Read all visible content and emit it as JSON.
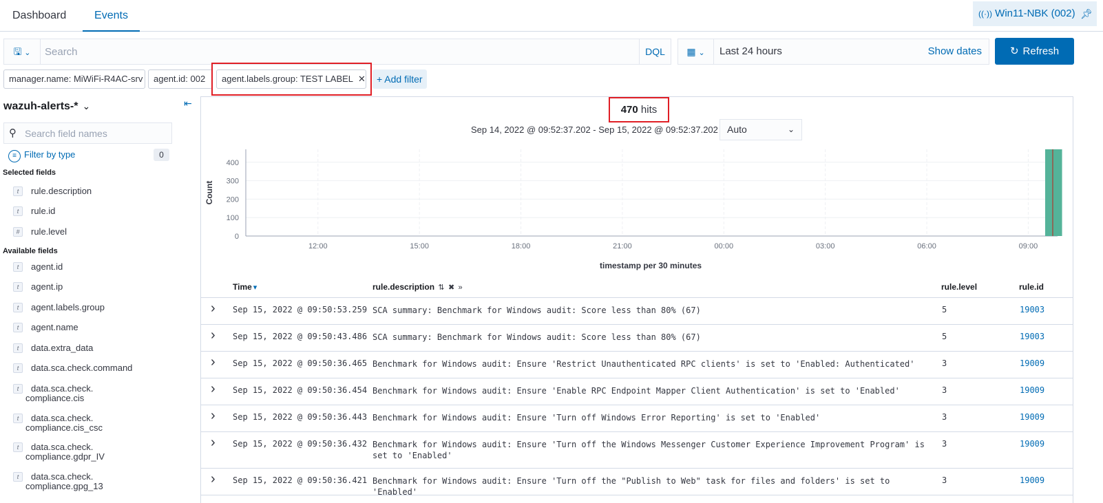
{
  "tabs": {
    "dashboard": "Dashboard",
    "events": "Events"
  },
  "agent_chip": {
    "label": "Win11-NBK (002)",
    "icon": "signal-icon",
    "pin_icon": "pin-icon"
  },
  "query": {
    "placeholder": "Search",
    "language": "DQL"
  },
  "date_picker": {
    "range": "Last 24 hours",
    "show_dates": "Show dates"
  },
  "refresh": {
    "label": "Refresh"
  },
  "filters": [
    {
      "label": "manager.name: MiWiFi-R4AC-srv"
    },
    {
      "label": "agent.id: 002"
    },
    {
      "label": "agent.labels.group: TEST LABEL"
    }
  ],
  "add_filter": "+ Add filter",
  "sidebar": {
    "index_pattern": "wazuh-alerts-*",
    "search_placeholder": "Search field names",
    "filter_by_type": "Filter by type",
    "filter_count": "0",
    "selected_title": "Selected fields",
    "selected_fields": [
      {
        "type": "t",
        "name": "rule.description"
      },
      {
        "type": "t",
        "name": "rule.id"
      },
      {
        "type": "#",
        "name": "rule.level"
      }
    ],
    "available_title": "Available fields",
    "available_fields": [
      {
        "type": "t",
        "name": "agent.id"
      },
      {
        "type": "t",
        "name": "agent.ip"
      },
      {
        "type": "t",
        "name": "agent.labels.group"
      },
      {
        "type": "t",
        "name": "agent.name"
      },
      {
        "type": "t",
        "name": "data.extra_data"
      },
      {
        "type": "t",
        "name": "data.sca.check.command"
      },
      {
        "type": "t",
        "name": "data.sca.check.",
        "name2": "compliance.cis"
      },
      {
        "type": "t",
        "name": "data.sca.check.",
        "name2": "compliance.cis_csc"
      },
      {
        "type": "t",
        "name": "data.sca.check.",
        "name2": "compliance.gdpr_IV"
      },
      {
        "type": "t",
        "name": "data.sca.check.",
        "name2": "compliance.gpg_13"
      }
    ]
  },
  "hits": {
    "count": "470",
    "label": "hits"
  },
  "time_range_label": "Sep 14, 2022 @ 09:52:37.202 - Sep 15, 2022 @ 09:52:37.202",
  "interval": "Auto",
  "colors": {
    "accent": "#006bb4",
    "bar": "#54b399",
    "highlight": "#e01e25",
    "marker": "#bd271e"
  },
  "chart_data": {
    "type": "bar",
    "ylabel": "Count",
    "xlabel": "timestamp per 30 minutes",
    "yticks": [
      0,
      100,
      200,
      300,
      400
    ],
    "ylim": [
      0,
      470
    ],
    "xticks": [
      "12:00",
      "15:00",
      "18:00",
      "21:00",
      "00:00",
      "03:00",
      "06:00",
      "09:00"
    ],
    "x_start": "09:52",
    "x_end": "09:52",
    "bars": [
      {
        "x": "09:30",
        "value": 470
      }
    ],
    "grid": true
  },
  "table": {
    "columns": {
      "time": "Time",
      "description": "rule.description",
      "level": "rule.level",
      "id": "rule.id"
    },
    "rows": [
      {
        "time": "Sep 15, 2022 @ 09:50:53.259",
        "description": "SCA summary: Benchmark for Windows audit: Score less than 80% (67)",
        "level": "5",
        "id": "19003"
      },
      {
        "time": "Sep 15, 2022 @ 09:50:43.486",
        "description": "SCA summary: Benchmark for Windows audit: Score less than 80% (67)",
        "level": "5",
        "id": "19003"
      },
      {
        "time": "Sep 15, 2022 @ 09:50:36.465",
        "description": "Benchmark for Windows audit: Ensure 'Restrict Unauthenticated RPC clients' is set to 'Enabled: Authenticated'",
        "level": "3",
        "id": "19009"
      },
      {
        "time": "Sep 15, 2022 @ 09:50:36.454",
        "description": "Benchmark for Windows audit: Ensure 'Enable RPC Endpoint Mapper Client Authentication' is set to 'Enabled'",
        "level": "3",
        "id": "19009"
      },
      {
        "time": "Sep 15, 2022 @ 09:50:36.443",
        "description": "Benchmark for Windows audit: Ensure 'Turn off Windows Error Reporting' is set to 'Enabled'",
        "level": "3",
        "id": "19009"
      },
      {
        "time": "Sep 15, 2022 @ 09:50:36.432",
        "description": "Benchmark for Windows audit: Ensure 'Turn off the Windows Messenger Customer Experience Improvement Program' is set to 'Enabled'",
        "level": "3",
        "id": "19009"
      },
      {
        "time": "Sep 15, 2022 @ 09:50:36.421",
        "description": "Benchmark for Windows audit: Ensure 'Turn off the \"Publish to Web\" task for files and folders' is set to 'Enabled'",
        "level": "3",
        "id": "19009"
      }
    ]
  }
}
